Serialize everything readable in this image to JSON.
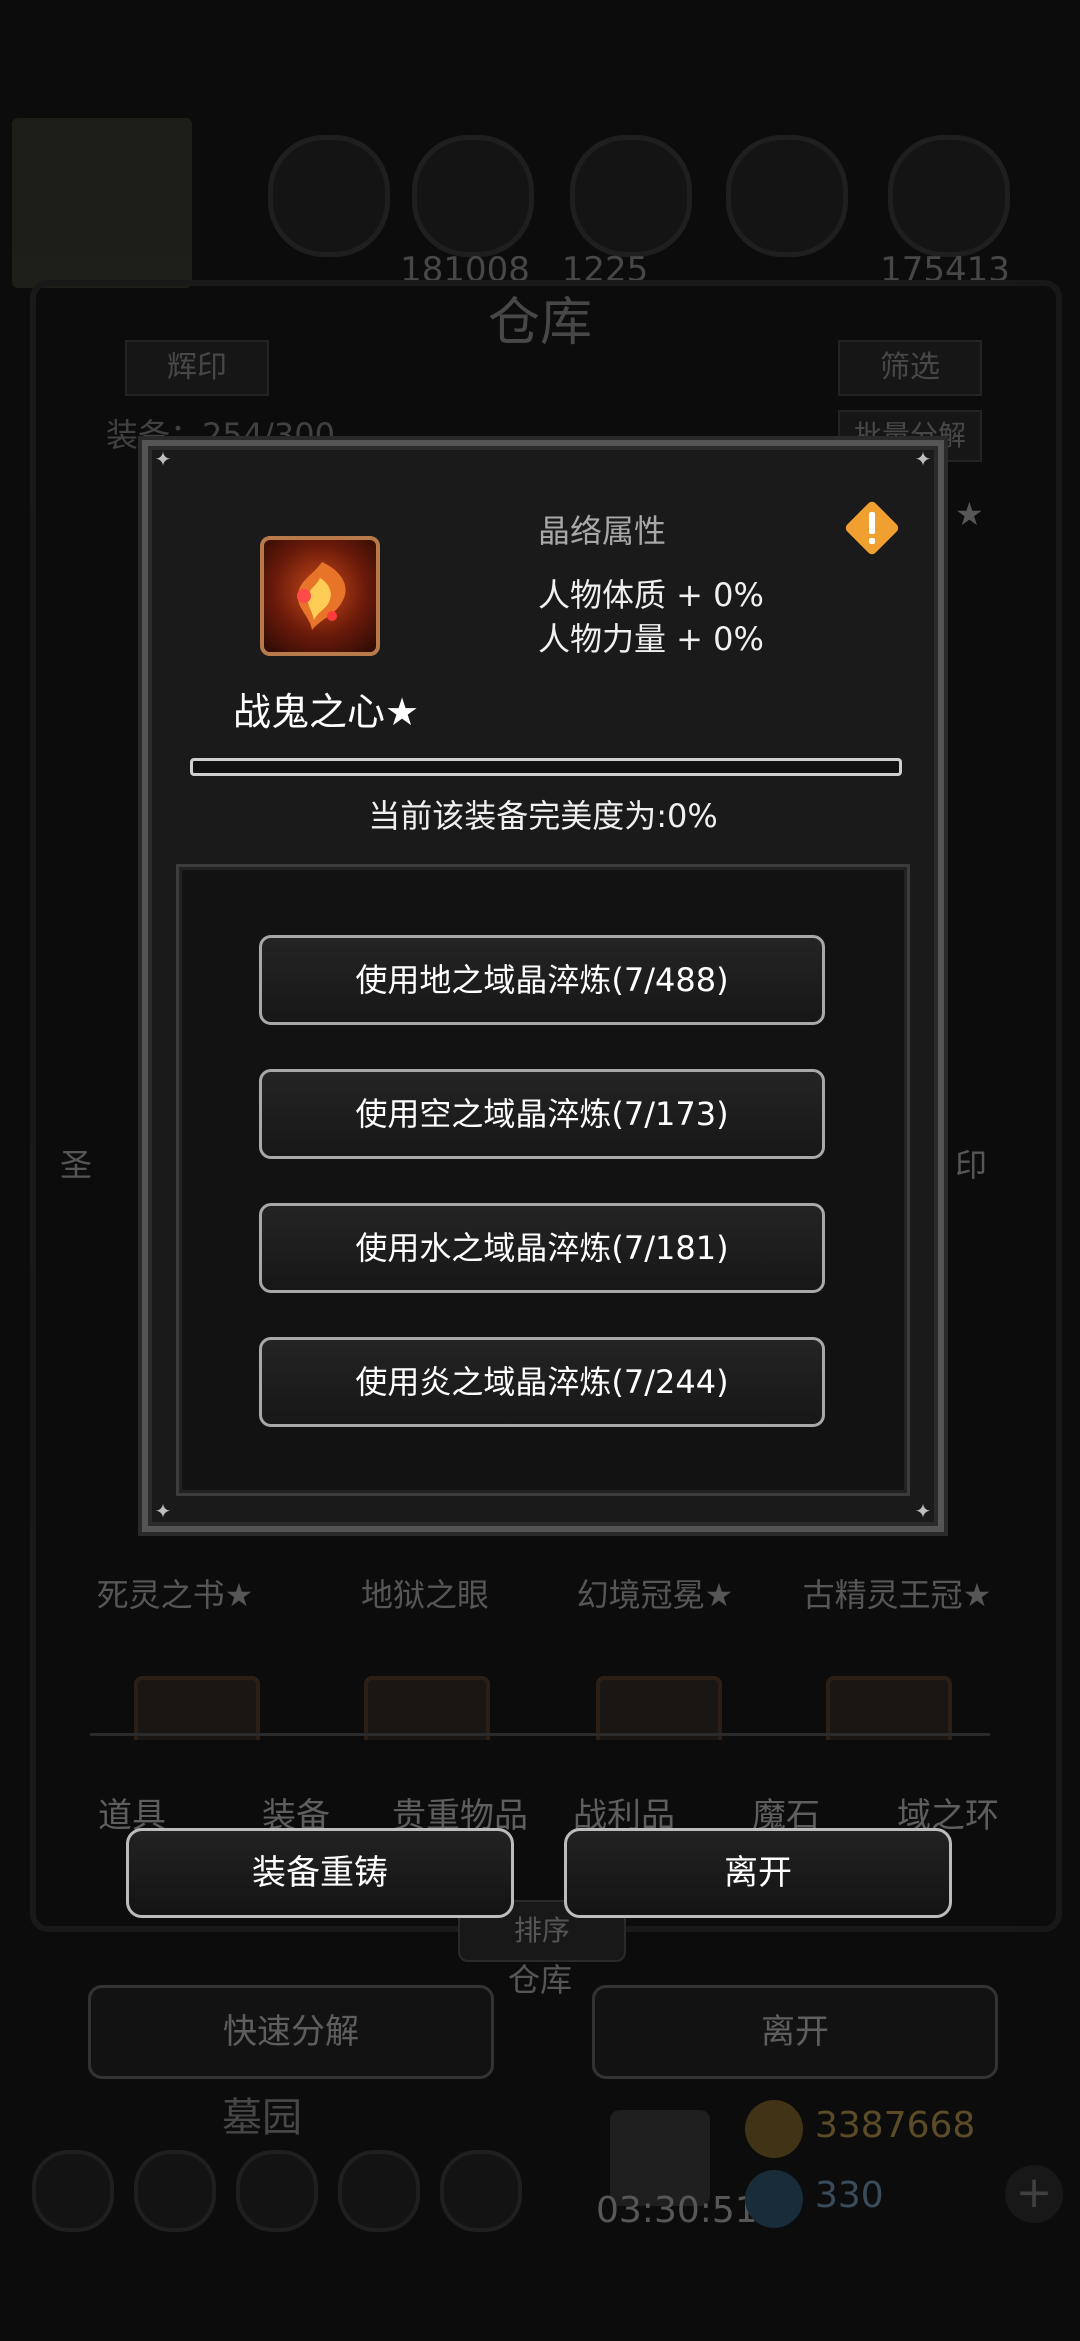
{
  "background": {
    "resources": [
      "",
      "181008",
      "1225",
      "",
      "175413"
    ],
    "title": "仓库",
    "left_tag": "辉印",
    "right_tag": "筛选",
    "storage_count": "装备：254/300",
    "batch_label": "批量分解",
    "items": [
      "死灵之书★",
      "地狱之眼",
      "幻境冠冕★",
      "古精灵王冠★"
    ],
    "side_labels": [
      "圣",
      "印",
      "★"
    ],
    "tabs": [
      "道具",
      "装备",
      "贵重物品",
      "战利品",
      "魔石",
      "域之环"
    ],
    "sort_label": "排序",
    "warehouse_label": "仓库",
    "quick_decompose": "快速分解",
    "leave": "离开",
    "cemetery": "墓园",
    "timer": "03:30:51",
    "gold": "3387668",
    "gems": "330"
  },
  "modal": {
    "item_name": "战鬼之心★",
    "attr_title": "晶络属性",
    "attributes": [
      "人物体质 + 0%",
      "人物力量 + 0%"
    ],
    "progress": 0,
    "perfection_text": "当前该装备完美度为:0%",
    "refine_buttons": [
      "使用地之域晶淬炼(7/488)",
      "使用空之域晶淬炼(7/173)",
      "使用水之域晶淬炼(7/181)",
      "使用炎之域晶淬炼(7/244)"
    ],
    "warning_color": "#f0a030"
  },
  "actions": {
    "reforge": "装备重铸",
    "leave": "离开"
  }
}
